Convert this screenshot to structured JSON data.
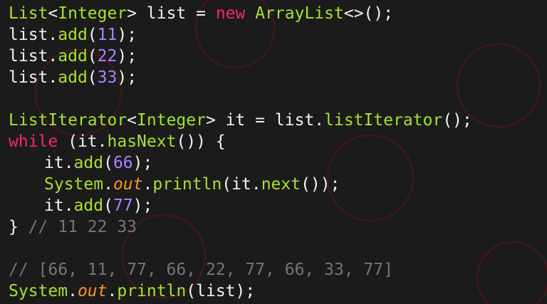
{
  "code": {
    "lines": [
      [
        {
          "t": "List",
          "c": "type"
        },
        {
          "t": "<",
          "c": "plain"
        },
        {
          "t": "Integer",
          "c": "type"
        },
        {
          "t": "> list = ",
          "c": "plain"
        },
        {
          "t": "new",
          "c": "kw"
        },
        {
          "t": " ",
          "c": "plain"
        },
        {
          "t": "ArrayList",
          "c": "type"
        },
        {
          "t": "<>();",
          "c": "plain"
        }
      ],
      [
        {
          "t": "list.",
          "c": "plain"
        },
        {
          "t": "add",
          "c": "method"
        },
        {
          "t": "(",
          "c": "plain"
        },
        {
          "t": "11",
          "c": "num"
        },
        {
          "t": ");",
          "c": "plain"
        }
      ],
      [
        {
          "t": "list.",
          "c": "plain"
        },
        {
          "t": "add",
          "c": "method"
        },
        {
          "t": "(",
          "c": "plain"
        },
        {
          "t": "22",
          "c": "num"
        },
        {
          "t": ");",
          "c": "plain"
        }
      ],
      [
        {
          "t": "list.",
          "c": "plain"
        },
        {
          "t": "add",
          "c": "method"
        },
        {
          "t": "(",
          "c": "plain"
        },
        {
          "t": "33",
          "c": "num"
        },
        {
          "t": ");",
          "c": "plain"
        }
      ],
      [],
      [
        {
          "t": "ListIterator",
          "c": "type"
        },
        {
          "t": "<",
          "c": "plain"
        },
        {
          "t": "Integer",
          "c": "type"
        },
        {
          "t": "> it = list.",
          "c": "plain"
        },
        {
          "t": "listIterator",
          "c": "method"
        },
        {
          "t": "();",
          "c": "plain"
        }
      ],
      [
        {
          "t": "while",
          "c": "kw"
        },
        {
          "t": " (it.",
          "c": "plain"
        },
        {
          "t": "hasNext",
          "c": "method"
        },
        {
          "t": "()) {",
          "c": "plain"
        }
      ],
      [
        {
          "t": "it.",
          "c": "plain",
          "indent": true
        },
        {
          "t": "add",
          "c": "method"
        },
        {
          "t": "(",
          "c": "plain"
        },
        {
          "t": "66",
          "c": "num"
        },
        {
          "t": ");",
          "c": "plain"
        }
      ],
      [
        {
          "t": "System",
          "c": "type",
          "indent": true
        },
        {
          "t": ".",
          "c": "plain"
        },
        {
          "t": "out",
          "c": "field"
        },
        {
          "t": ".",
          "c": "plain"
        },
        {
          "t": "println",
          "c": "method"
        },
        {
          "t": "(it.",
          "c": "plain"
        },
        {
          "t": "next",
          "c": "method"
        },
        {
          "t": "());",
          "c": "plain"
        }
      ],
      [
        {
          "t": "it.",
          "c": "plain",
          "indent": true
        },
        {
          "t": "add",
          "c": "method"
        },
        {
          "t": "(",
          "c": "plain"
        },
        {
          "t": "77",
          "c": "num"
        },
        {
          "t": ");",
          "c": "plain"
        }
      ],
      [
        {
          "t": "} ",
          "c": "plain"
        },
        {
          "t": "// 11 22 33",
          "c": "comment"
        }
      ],
      [],
      [
        {
          "t": "// [66, 11, 77, 66, 22, 77, 66, 33, 77]",
          "c": "comment"
        }
      ],
      [
        {
          "t": "System",
          "c": "type"
        },
        {
          "t": ".",
          "c": "plain"
        },
        {
          "t": "out",
          "c": "field"
        },
        {
          "t": ".",
          "c": "plain"
        },
        {
          "t": "println",
          "c": "method"
        },
        {
          "t": "(list);",
          "c": "plain"
        }
      ]
    ]
  },
  "colors": {
    "background": "#1b1b1c",
    "type": "#a6e22e",
    "keyword": "#f92672",
    "number": "#ae81ff",
    "field": "#fd971f",
    "comment": "#767676",
    "text": "#f2f2f2",
    "watermark": "#8a1a1a"
  }
}
